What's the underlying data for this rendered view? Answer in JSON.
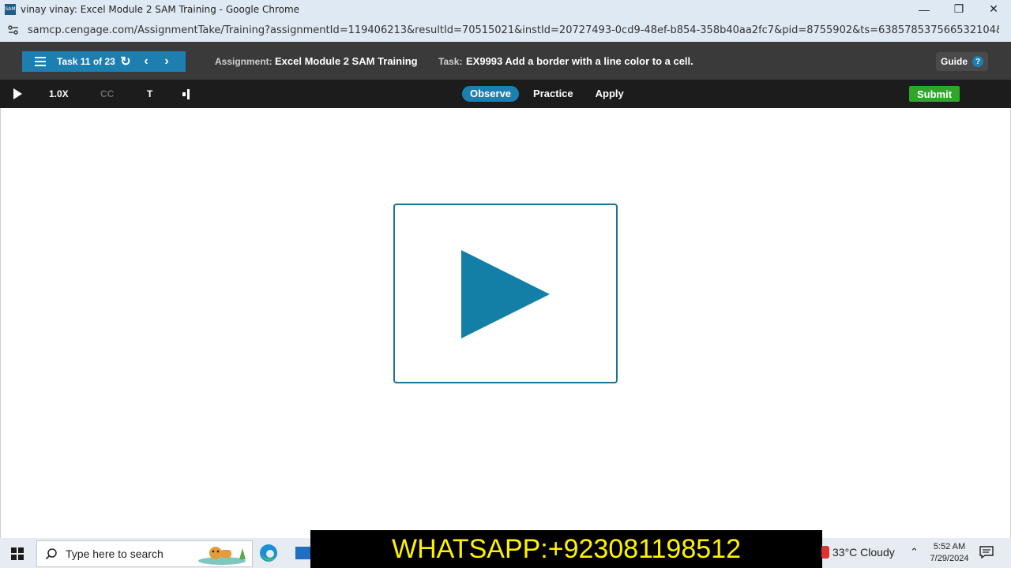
{
  "browser": {
    "window_title": "vinay vinay: Excel Module 2 SAM Training - Google Chrome",
    "app_icon_text": "SAM",
    "url": "samcp.cengage.com/AssignmentTake/Training?assignmentId=119406213&resultId=70515021&instId=20727493-0cd9-48ef-b854-358b40aa2fc7&pid=8755902&ts=638578537566532104&uid=SAM&Correlatio..."
  },
  "topbar": {
    "task_counter": "Task 11 of 23",
    "assignment_label": "Assignment:",
    "assignment_value": "Excel Module 2 SAM Training",
    "task_label": "Task:",
    "task_value": "EX9993 Add a border with a line color to a cell.",
    "guide_label": "Guide",
    "guide_icon": "?"
  },
  "mediabar": {
    "speed": "1.0X",
    "cc": "CC",
    "text_toggle": "T",
    "modes": [
      "Observe",
      "Practice",
      "Apply"
    ],
    "active_mode": "Observe",
    "submit_label": "Submit"
  },
  "content": {
    "video_state": "paused"
  },
  "taskbar": {
    "search_placeholder": "Type here to search",
    "weather": "33°C  Cloudy",
    "time": "5:52 AM",
    "date": "7/29/2024"
  },
  "overlay": {
    "whatsapp_banner": "WHATSAPP:+923081198512"
  },
  "colors": {
    "accent_blue": "#1d7fb0",
    "submit_green": "#2fa52c",
    "banner_yellow": "#fff200"
  }
}
